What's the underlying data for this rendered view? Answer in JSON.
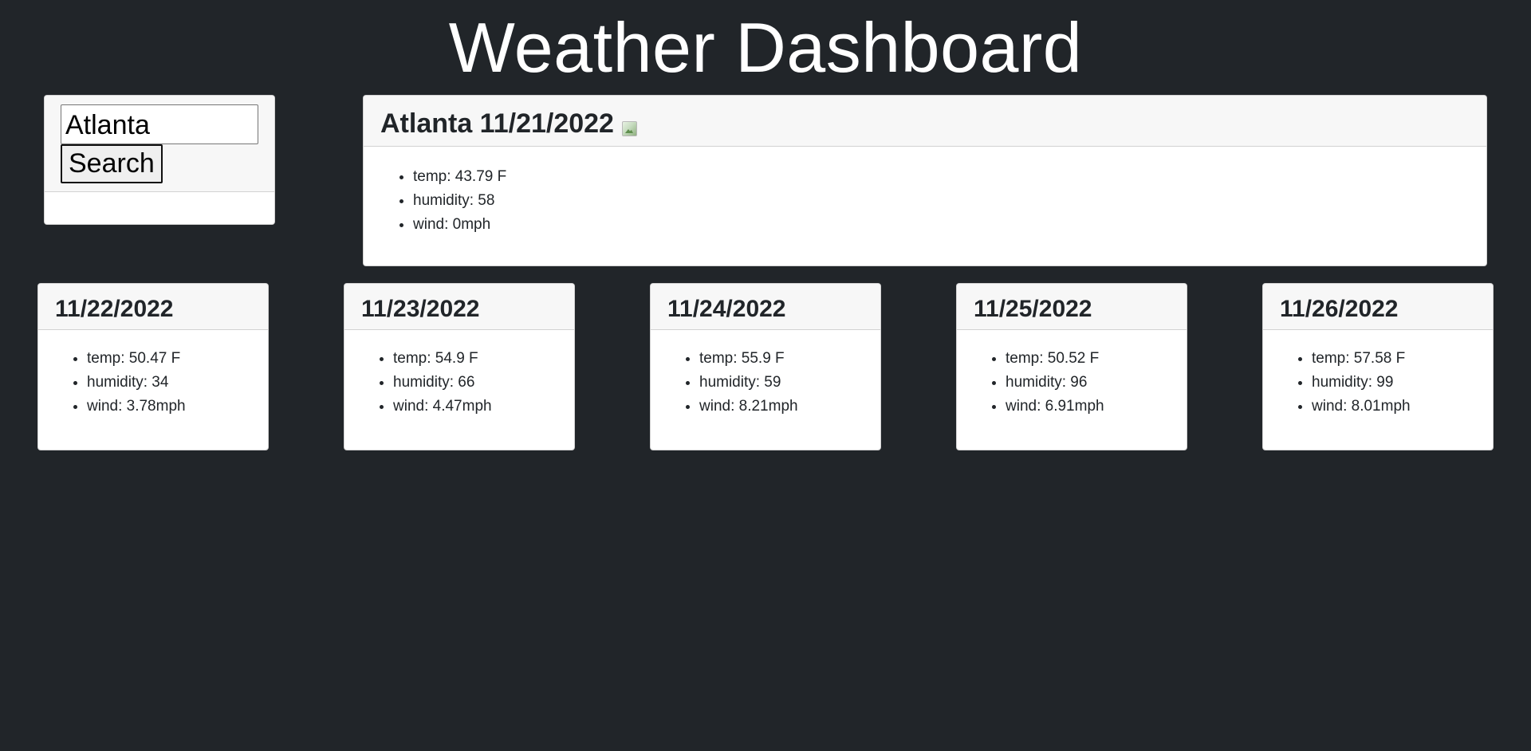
{
  "header": {
    "title": "Weather Dashboard"
  },
  "search": {
    "input_value": "Atlanta",
    "button_label": "Search"
  },
  "current": {
    "title": "Atlanta 11/21/2022",
    "temp": "temp: 43.79 F",
    "humidity": "humidity: 58",
    "wind": "wind: 0mph"
  },
  "forecast": [
    {
      "date": "11/22/2022",
      "temp": "temp: 50.47 F",
      "humidity": "humidity: 34",
      "wind": "wind: 3.78mph"
    },
    {
      "date": "11/23/2022",
      "temp": "temp: 54.9 F",
      "humidity": "humidity: 66",
      "wind": "wind: 4.47mph"
    },
    {
      "date": "11/24/2022",
      "temp": "temp: 55.9 F",
      "humidity": "humidity: 59",
      "wind": "wind: 8.21mph"
    },
    {
      "date": "11/25/2022",
      "temp": "temp: 50.52 F",
      "humidity": "humidity: 96",
      "wind": "wind: 6.91mph"
    },
    {
      "date": "11/26/2022",
      "temp": "temp: 57.58 F",
      "humidity": "humidity: 99",
      "wind": "wind: 8.01mph"
    }
  ],
  "icons": {
    "current_weather": "broken-image-icon"
  },
  "colors": {
    "page_background": "#212529",
    "card_background": "#ffffff",
    "card_header_background": "#f7f7f7",
    "title_text": "#ffffff"
  }
}
